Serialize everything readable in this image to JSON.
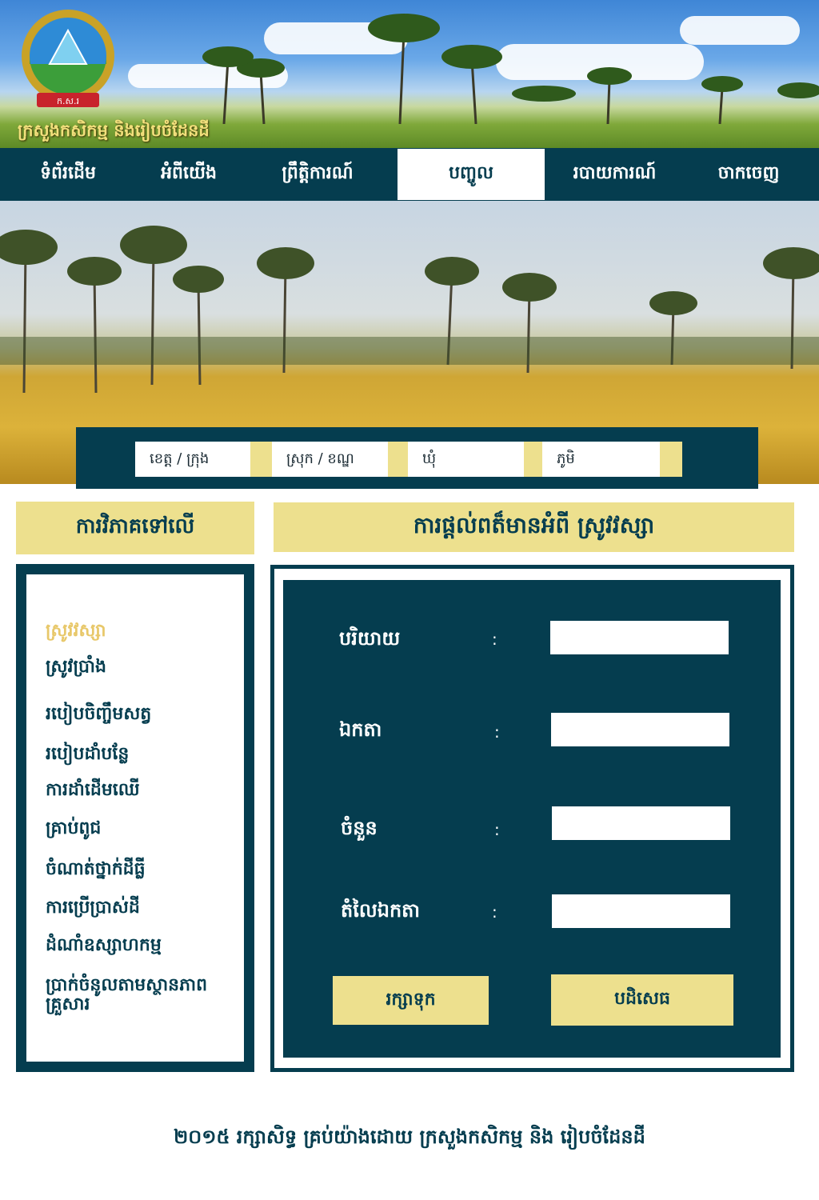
{
  "header": {
    "title": "ក្រសួងកសិកម្ម និងរៀបចំដែនដី",
    "logo_text": "ក.ស.រ",
    "logo_icon": "ministry-emblem-icon"
  },
  "nav": {
    "items": [
      {
        "label": "ទំព័រដើម",
        "active": false
      },
      {
        "label": "អំពីយើង",
        "active": false
      },
      {
        "label": "ព្រឹត្តិការណ៍",
        "active": false
      },
      {
        "label": "បញ្ចូល",
        "active": true
      },
      {
        "label": "របាយការណ៍",
        "active": false
      },
      {
        "label": "ចាកចេញ",
        "active": false
      }
    ]
  },
  "filters": {
    "province": "ខេត្ត / ក្រុង",
    "district": "ស្រុក /  ខណ្ឌ",
    "commune": "ឃុំ",
    "village": "ភូមិ"
  },
  "sidebar": {
    "title": "ការវិភាគទៅលើ",
    "items": [
      {
        "label": "ស្រូវវស្សា",
        "active": true
      },
      {
        "label": "ស្រូវប្រាំង",
        "active": false
      },
      {
        "label": "របៀបចិញ្ចឹមសត្វ",
        "active": false
      },
      {
        "label": "របៀបដាំបន្លែ",
        "active": false
      },
      {
        "label": "ការដាំដើមឈើ",
        "active": false
      },
      {
        "label": "គ្រាប់ពូជ",
        "active": false
      },
      {
        "label": "ចំណាត់ថ្នាក់ដីធ្លី",
        "active": false
      },
      {
        "label": "ការប្រើប្រាស់ដី",
        "active": false
      },
      {
        "label": "ដំណាំឧស្សាហកម្ម",
        "active": false
      },
      {
        "label": "ប្រាក់ចំនូលតាមស្ថានភាពគ្រួសារ",
        "active": false
      }
    ]
  },
  "main": {
    "title": "ការផ្ដល់ពត៏មានអំពី ស្រូវវស្សា",
    "form": {
      "fields": [
        {
          "label": "បរិយាយ",
          "colon": ":",
          "value": ""
        },
        {
          "label": "ឯកតា",
          "colon": ":",
          "value": ""
        },
        {
          "label": "ចំនួន",
          "colon": ":",
          "value": ""
        },
        {
          "label": "តំលៃឯកតា",
          "colon": ":",
          "value": ""
        }
      ],
      "save_label": "រក្សាទុក",
      "cancel_label": "បដិសេធ"
    }
  },
  "footer": {
    "text": "២០១៥ រក្សាសិទ្ធ គ្រប់យ៉ាងដោយ ក្រសួងកសិកម្ម និង រៀបចំដែនដី"
  },
  "colors": {
    "primary": "#053d4f",
    "accent": "#ede08e",
    "active_sidebar": "#e8c86a",
    "title_text": "#f2e07c"
  }
}
